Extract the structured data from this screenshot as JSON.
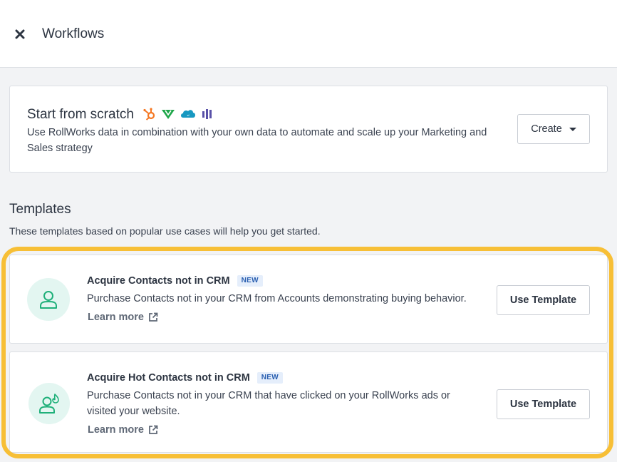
{
  "header": {
    "title": "Workflows",
    "close_icon": "close-icon"
  },
  "scratch": {
    "title": "Start from scratch",
    "brand_icons": [
      "hubspot-icon",
      "marketo-icon",
      "salesforce-icon",
      "outreach-icon"
    ],
    "description": "Use RollWorks data in combination with your own data to automate and scale up your Marketing and Sales strategy",
    "create_label": "Create"
  },
  "templates": {
    "heading": "Templates",
    "subtitle": "These templates based on popular use cases will help you get started.",
    "highlight_color": "#f7bf36",
    "items": [
      {
        "title": "Acquire Contacts not in CRM",
        "badge": "NEW",
        "description": "Purchase Contacts not in your CRM from Accounts demonstrating buying behavior.",
        "learn_more": "Learn more",
        "button": "Use Template",
        "icon": "person-icon"
      },
      {
        "title": "Acquire Hot Contacts not in CRM",
        "badge": "NEW",
        "description": "Purchase Contacts not in your CRM that have clicked on your RollWorks ads or visited your website.",
        "learn_more": "Learn more",
        "button": "Use Template",
        "icon": "hot-person-icon"
      }
    ]
  },
  "colors": {
    "accent_green": "#1fb07a",
    "avatar_bg": "#e3f6f1",
    "badge_bg": "#e5eefb",
    "badge_text": "#2a5fb0"
  }
}
